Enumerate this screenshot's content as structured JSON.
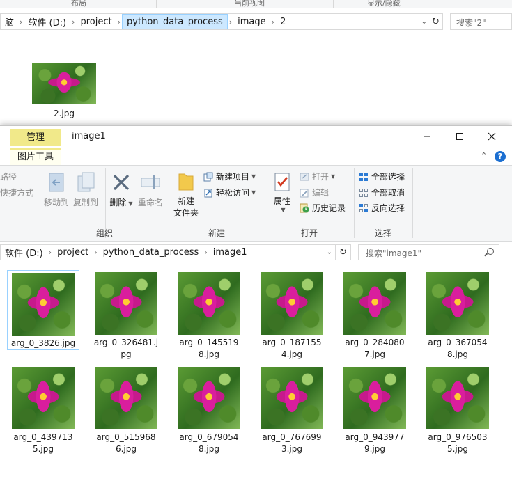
{
  "background_window": {
    "ribbon_groups": [
      "布局",
      "当前视图",
      "显示/隐藏"
    ],
    "breadcrumb": [
      "脑",
      "软件 (D:)",
      "project",
      "python_data_process",
      "image",
      "2"
    ],
    "search_placeholder": "搜索\"2\"",
    "file": {
      "name": "2.jpg"
    }
  },
  "window": {
    "title": "image1",
    "context_tab": "管理",
    "tool_tab": "图片工具",
    "ribbon": {
      "partial_left": [
        "路径",
        "快捷方式"
      ],
      "organize": {
        "label": "组织",
        "move_to": "移动到",
        "copy_to": "复制到",
        "delete": "删除",
        "rename": "重命名"
      },
      "new": {
        "label": "新建",
        "new_folder_line1": "新建",
        "new_folder_line2": "文件夹",
        "new_item": "新建项目",
        "easy_access": "轻松访问"
      },
      "open": {
        "label": "打开",
        "properties": "属性",
        "open": "打开",
        "edit": "编辑",
        "history": "历史记录"
      },
      "select": {
        "label": "选择",
        "select_all": "全部选择",
        "select_none": "全部取消",
        "invert": "反向选择"
      }
    },
    "breadcrumb": [
      "软件 (D:)",
      "project",
      "python_data_process",
      "image1"
    ],
    "search_placeholder": "搜索\"image1\"",
    "files": [
      {
        "name": "arg_0_3826.jpg",
        "selected": true
      },
      {
        "name": "arg_0_326481.jpg"
      },
      {
        "name": "arg_0_1455198.jpg"
      },
      {
        "name": "arg_0_1871554.jpg"
      },
      {
        "name": "arg_0_2840807.jpg"
      },
      {
        "name": "arg_0_3670548.jpg"
      },
      {
        "name": "arg_0_4397135.jpg"
      },
      {
        "name": "arg_0_5159686.jpg"
      },
      {
        "name": "arg_0_6790548.jpg"
      },
      {
        "name": "arg_0_7676993.jpg"
      },
      {
        "name": "arg_0_9439779.jpg"
      },
      {
        "name": "arg_0_9765035.jpg"
      }
    ]
  }
}
